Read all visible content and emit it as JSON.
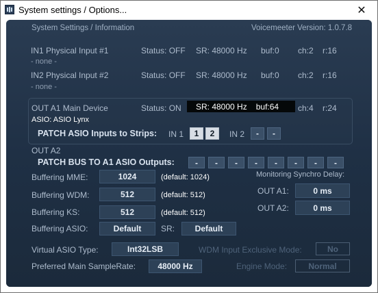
{
  "window": {
    "title": "System settings / Options...",
    "close_glyph": "✕"
  },
  "header": {
    "section": "System Settings / Information",
    "version": "Voicemeeter Version: 1.0.7.8"
  },
  "inputs": [
    {
      "name": "IN1 Physical Input #1",
      "device": "- none -",
      "status": "Status: OFF",
      "sr": "SR: 48000 Hz",
      "buf": "buf:0",
      "ch": "ch:2",
      "r": "r:16"
    },
    {
      "name": "IN2 Physical Input #2",
      "device": "- none -",
      "status": "Status: OFF",
      "sr": "SR: 48000 Hz",
      "buf": "buf:0",
      "ch": "ch:2",
      "r": "r:16"
    }
  ],
  "out_a1": {
    "name": "OUT A1 Main Device",
    "device": "ASIO: ASIO Lynx",
    "status": "Status: ON",
    "sr": "SR: 48000 Hz",
    "buf": "buf:64",
    "ch": "ch:4",
    "r": "r:24",
    "patch_label": "PATCH ASIO Inputs to Strips:",
    "in1_label": "IN 1",
    "in1_buttons": [
      "1",
      "2"
    ],
    "in2_label": "IN 2",
    "in2_buttons": [
      "-",
      "-"
    ]
  },
  "out_a2": {
    "name": "OUT A2",
    "patch_label": "PATCH BUS TO A1 ASIO Outputs:",
    "buttons": [
      "-",
      "-",
      "-",
      "-",
      "-",
      "-",
      "-",
      "-"
    ]
  },
  "buffering": [
    {
      "label": "Buffering MME:",
      "value": "1024",
      "default": "(default: 1024)"
    },
    {
      "label": "Buffering WDM:",
      "value": "512",
      "default": "(default: 512)"
    },
    {
      "label": "Buffering KS:",
      "value": "512",
      "default": "(default: 512)"
    }
  ],
  "buffering_asio": {
    "label": "Buffering ASIO:",
    "value": "Default",
    "sr_label": "SR:",
    "sr_value": "Default"
  },
  "synchro": {
    "title": "Monitoring Synchro Delay:",
    "a1_label": "OUT A1:",
    "a1_value": "0 ms",
    "a2_label": "OUT A2:",
    "a2_value": "0 ms"
  },
  "virtual_asio": {
    "label": "Virtual ASIO Type:",
    "value": "Int32LSB"
  },
  "samplerate": {
    "label": "Preferred Main SampleRate:",
    "value": "48000 Hz"
  },
  "wdm_exclusive": {
    "label": "WDM Input Exclusive Mode:",
    "value": "No"
  },
  "engine_mode": {
    "label": "Engine Mode:",
    "value": "Normal"
  }
}
